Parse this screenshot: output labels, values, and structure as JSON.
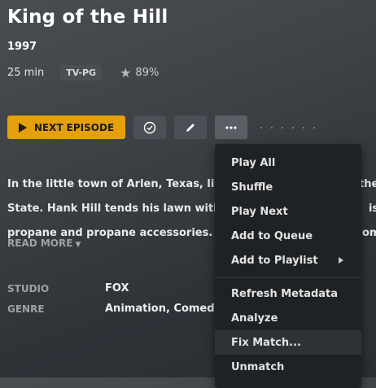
{
  "show": {
    "title": "King of the Hill",
    "year": "1997",
    "duration": "25 min",
    "content_rating": "TV-PG",
    "audience_score": "89%"
  },
  "actions": {
    "next_episode_label": "NEXT EPISODE",
    "watched_icon": "check-circle-icon",
    "edit_icon": "pencil-icon",
    "more_icon": "more-horizontal-icon"
  },
  "summary": {
    "lines": [
      "In the little town of Arlen, Texas, live",
      "State. Hank Hill tends his lawn with",
      "propane and propane accessories. I"
    ],
    "line_endings": [
      "the",
      "is",
      "om"
    ],
    "read_more_label": "READ MORE"
  },
  "details": {
    "studio_label": "STUDIO",
    "studio_value": "FOX",
    "genre_label": "GENRE",
    "genre_value": "Animation, Comed"
  },
  "menu": {
    "items": [
      {
        "label": "Play All"
      },
      {
        "label": "Shuffle"
      },
      {
        "label": "Play Next"
      },
      {
        "label": "Add to Queue"
      },
      {
        "label": "Add to Playlist"
      },
      {
        "label": "Refresh Metadata"
      },
      {
        "label": "Analyze"
      },
      {
        "label": "Fix Match..."
      },
      {
        "label": "Unmatch"
      }
    ],
    "highlighted": "Fix Match..."
  },
  "colors": {
    "accent": "#e5a00d",
    "menu_bg": "#1f2225",
    "muted_text": "#9ea2a6"
  }
}
